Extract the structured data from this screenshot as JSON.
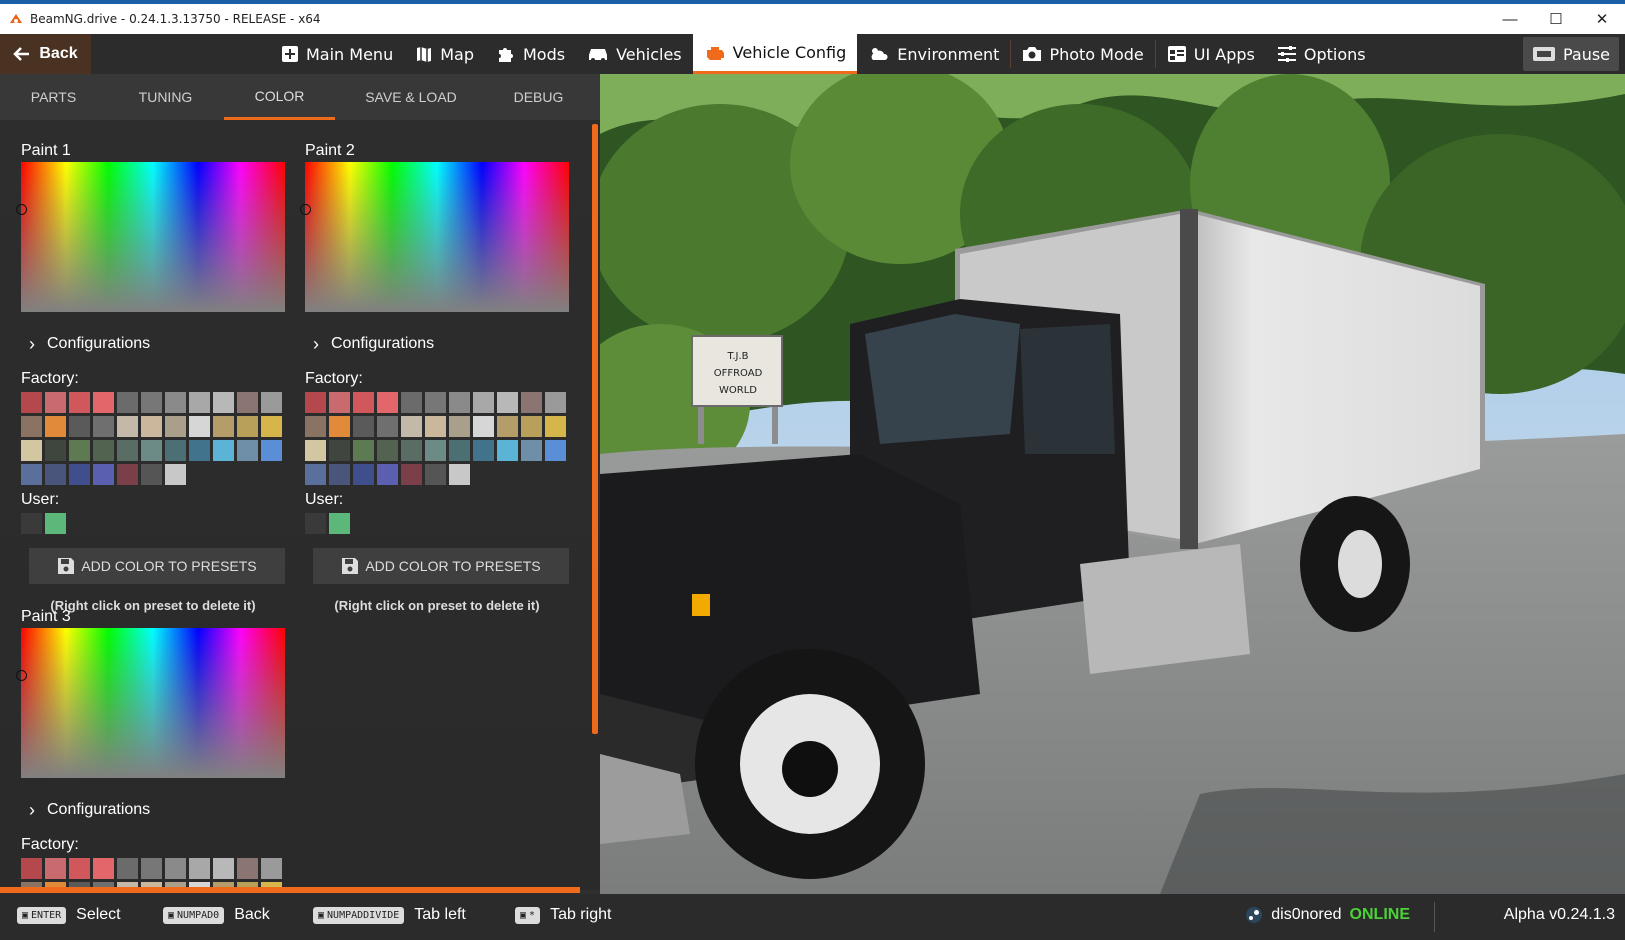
{
  "window": {
    "title": "BeamNG.drive - 0.24.1.3.13750 - RELEASE - x64",
    "controls": [
      "minimize-icon",
      "maximize-icon",
      "close-icon"
    ]
  },
  "topnav": {
    "back_label": "Back",
    "items": [
      {
        "label": "Main Menu",
        "icon": "main-menu-icon"
      },
      {
        "label": "Map",
        "icon": "map-icon"
      },
      {
        "label": "Mods",
        "icon": "puzzle-icon"
      },
      {
        "label": "Vehicles",
        "icon": "car-icon"
      },
      {
        "label": "Vehicle Config",
        "icon": "engine-icon",
        "active": true
      },
      {
        "label": "Environment",
        "icon": "weather-icon"
      },
      {
        "label": "Photo Mode",
        "icon": "camera-icon"
      },
      {
        "label": "UI Apps",
        "icon": "apps-icon"
      },
      {
        "label": "Options",
        "icon": "sliders-icon"
      }
    ],
    "pause_label": "Pause"
  },
  "tabs": [
    {
      "label": "PARTS"
    },
    {
      "label": "TUNING"
    },
    {
      "label": "COLOR",
      "active": true
    },
    {
      "label": "SAVE & LOAD"
    },
    {
      "label": "DEBUG"
    }
  ],
  "paints": [
    {
      "title": "Paint 1"
    },
    {
      "title": "Paint 2"
    },
    {
      "title": "Paint 3"
    }
  ],
  "common": {
    "configurations": "Configurations",
    "factory": "Factory:",
    "user": "User:",
    "add_preset": "ADD COLOR TO PRESETS",
    "hint": "(Right click on preset to delete it)"
  },
  "factory_colors": [
    "#b5484c",
    "#c96a6e",
    "#d0585c",
    "#e3666a",
    "#6b6b6b",
    "#777777",
    "#8a8a8a",
    "#a8a8a8",
    "#b8b8b8",
    "#8a7572",
    "#9a9a9a",
    "#8a7362",
    "#e08a3a",
    "#5a5a5a",
    "#6f6f6f",
    "#c4b8a8",
    "#cbb79c",
    "#a99f8b",
    "#d6d6d6",
    "#b59d6a",
    "#b9a05a",
    "#d6b64a",
    "#d2c7a0",
    "#3f463e",
    "#5d7a52",
    "#52634f",
    "#5a6d64",
    "#6d8b86",
    "#4b6f73",
    "#41738c",
    "#5bb4d6",
    "#6f8fa8",
    "#5a8ed6",
    "#5a6f9c",
    "#49557a",
    "#3f4f8c",
    "#5a5fb0",
    "#7a3f48",
    "#555555",
    "#c8c8c8"
  ],
  "user_colors": [
    "#3a3a3a",
    "#5cb87a"
  ],
  "viewport": {
    "sign_text": [
      "T.J.B",
      "OFFROAD",
      "WORLD"
    ]
  },
  "bottombar": {
    "hotkeys": [
      {
        "key": "ENTER",
        "action": "Select"
      },
      {
        "key": "NUMPAD0",
        "action": "Back"
      },
      {
        "key": "NUMPADDIVIDE",
        "action": "Tab left"
      },
      {
        "key": "*",
        "action": "Tab right"
      }
    ],
    "username": "dis0nored",
    "status": "ONLINE",
    "version": "Alpha v0.24.1.3"
  },
  "colors": {
    "accent": "#f06a1b",
    "online": "#4cd137"
  }
}
